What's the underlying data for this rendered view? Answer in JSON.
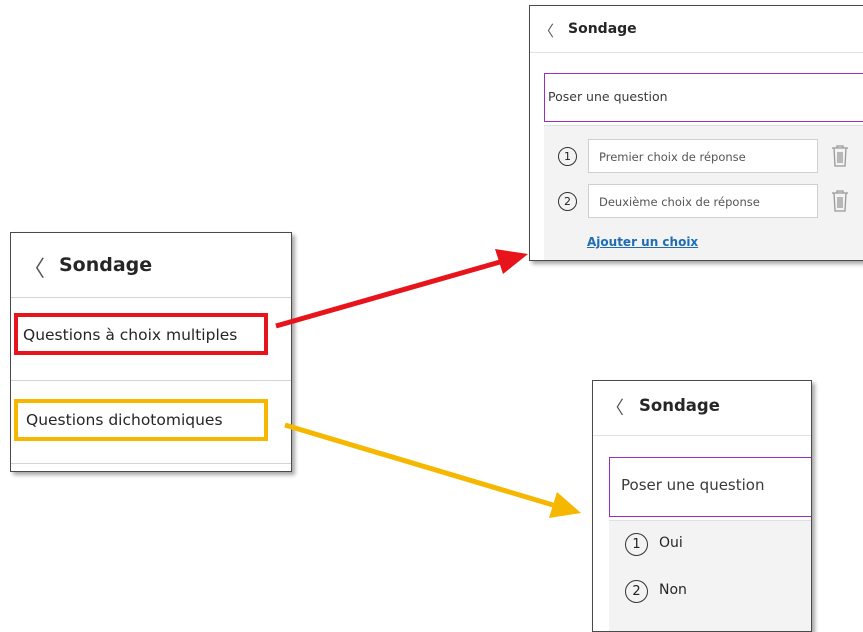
{
  "left_panel": {
    "back_glyph": "〈",
    "title": "Sondage",
    "options": [
      {
        "label": "Questions à choix multiples",
        "highlight_color": "#e8141b"
      },
      {
        "label": "Questions dichotomiques",
        "highlight_color": "#f5b700"
      }
    ]
  },
  "multiple_choice_panel": {
    "back_glyph": "〈",
    "title": "Sondage",
    "question_placeholder": "Poser une question",
    "choices": [
      {
        "number": "1",
        "placeholder": "Premier choix de réponse"
      },
      {
        "number": "2",
        "placeholder": "Deuxième choix de réponse"
      }
    ],
    "add_choice_label": "Ajouter un choix"
  },
  "yes_no_panel": {
    "back_glyph": "〈",
    "title": "Sondage",
    "question_placeholder": "Poser une question",
    "answers": [
      {
        "number": "1",
        "label": "Oui"
      },
      {
        "number": "2",
        "label": "Non"
      }
    ]
  },
  "colors": {
    "red_arrow": "#e8141b",
    "yellow_arrow": "#f5b700",
    "question_border": "#9a2fb8",
    "link": "#1e6cb3"
  }
}
